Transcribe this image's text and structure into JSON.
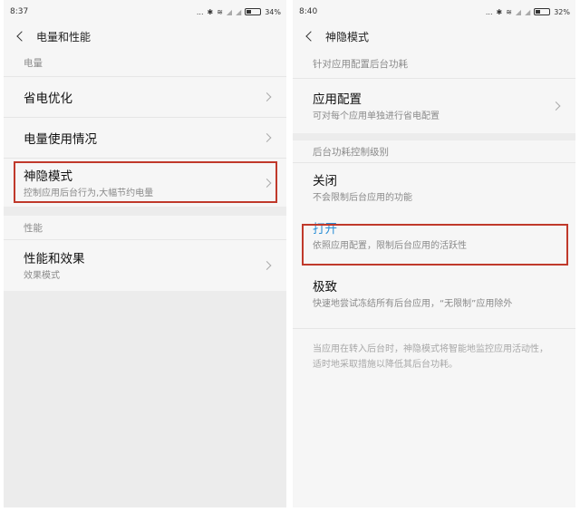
{
  "left": {
    "status": {
      "time": "8:37",
      "dots": "...",
      "battery": "34%",
      "battery_level": 0.34
    },
    "title": "电量和性能",
    "sections": [
      {
        "header": "电量",
        "items": [
          {
            "title": "省电优化"
          },
          {
            "title": "电量使用情况"
          },
          {
            "title": "神隐模式",
            "subtitle": "控制应用后台行为,大幅节约电量"
          }
        ]
      },
      {
        "header": "性能",
        "items": [
          {
            "title": "性能和效果",
            "subtitle": "效果模式"
          }
        ]
      }
    ]
  },
  "right": {
    "status": {
      "time": "8:40",
      "dots": "...",
      "battery": "32%",
      "battery_level": 0.32
    },
    "title": "神隐模式",
    "section1": {
      "header": "针对应用配置后台功耗",
      "item": {
        "title": "应用配置",
        "subtitle": "可对每个应用单独进行省电配置"
      }
    },
    "section2": {
      "header": "后台功耗控制级别",
      "options": [
        {
          "title": "关闭",
          "subtitle": "不会限制后台应用的功能"
        },
        {
          "title": "打开",
          "subtitle": "依照应用配置，限制后台应用的活跃性"
        },
        {
          "title": "极致",
          "subtitle": "快速地尝试冻结所有后台应用，“无限制”应用除外"
        }
      ]
    },
    "note": "当应用在转入后台时，神隐模式将智能地监控应用活动性，适时地采取措施以降低其后台功耗。"
  },
  "colors": {
    "highlight_border": "#c0392b",
    "accent": "#2b8fd6"
  }
}
